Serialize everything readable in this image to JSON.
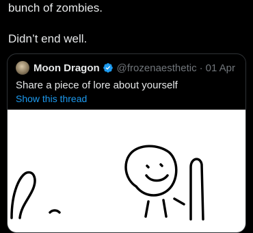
{
  "post": {
    "line1": "bunch of zombies.",
    "line2": "Didn’t end well."
  },
  "quote": {
    "author_name": "Moon Dragon",
    "verified_icon": "verified-badge-icon",
    "handle": "@frozenaesthetic",
    "separator": "·",
    "date": "01 Apr",
    "text": "Share a piece of lore about yourself",
    "show_thread": "Show this thread"
  },
  "colors": {
    "background": "#000000",
    "text": "#e7e9ea",
    "muted": "#71767b",
    "link": "#1d9bf0",
    "border": "#2f3336"
  }
}
